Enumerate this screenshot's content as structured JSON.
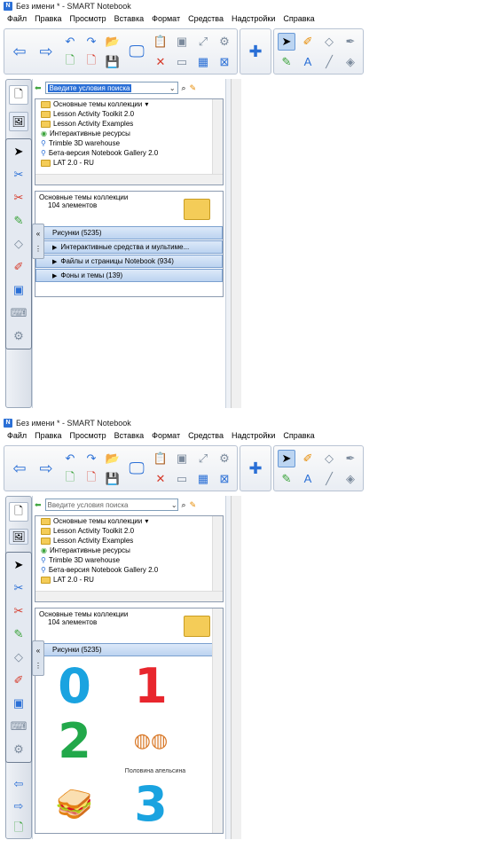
{
  "app": {
    "title": "Без имени * - SMART Notebook"
  },
  "menu": [
    "Файл",
    "Правка",
    "Просмотр",
    "Вставка",
    "Формат",
    "Средства",
    "Надстройки",
    "Справка"
  ],
  "gallery": {
    "search_placeholder": "Введите условия поиска",
    "tree": [
      "Основные темы коллекции",
      "Lesson Activity Toolkit 2.0",
      "Lesson Activity Examples",
      "Интерактивные ресурсы",
      "Trimble 3D warehouse",
      "Бета-версия Notebook Gallery 2.0",
      "LAT 2.0 - RU"
    ],
    "collection_title": "Основные темы коллекции",
    "collection_count": "104 элементов",
    "categories_1": [
      "Рисунки (5235)",
      "Интерактивные средства и мультиме...",
      "Файлы и страницы Notebook (934)",
      "Фоны и темы (139)"
    ],
    "categories_2": [
      "Рисунки (5235)"
    ],
    "thumbs": [
      {
        "glyph": "0",
        "color": "#1aa3e0",
        "caption": ""
      },
      {
        "glyph": "1",
        "color": "#e8262d",
        "caption": ""
      },
      {
        "glyph": "2",
        "color": "#22a84a",
        "caption": ""
      },
      {
        "glyph": "◍◍",
        "color": "#d97a2a",
        "caption": "Половина апельсина"
      },
      {
        "glyph": "🥪",
        "color": "#8a5a2a",
        "caption": ""
      },
      {
        "glyph": "3",
        "color": "#1aa3e0",
        "caption": ""
      }
    ]
  },
  "icons": {
    "back": "←",
    "forward": "→",
    "undo": "↶",
    "redo": "↷",
    "open": "📂",
    "pointer": "➤",
    "search": "⌕",
    "pin": "✎",
    "collapse": "«",
    "grid": "⋮⋮"
  }
}
